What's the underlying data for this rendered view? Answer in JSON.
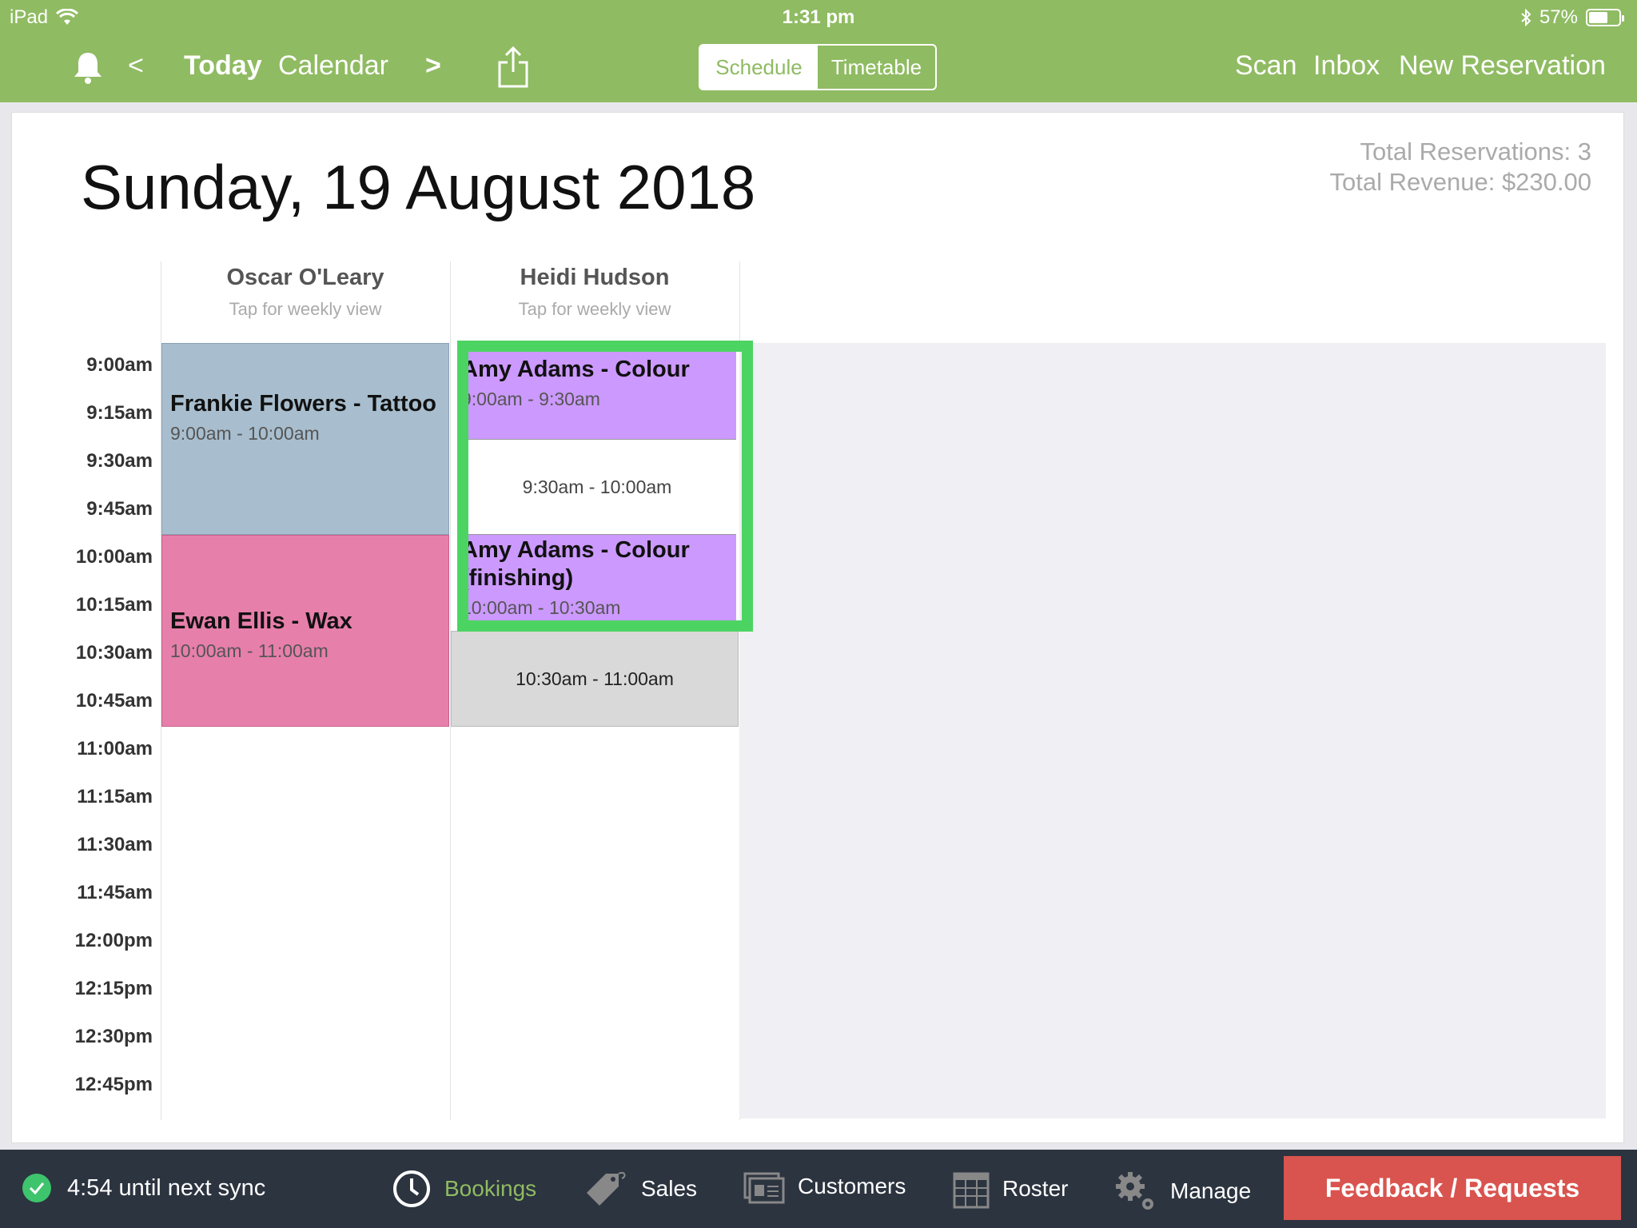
{
  "status_bar": {
    "device": "iPad",
    "time": "1:31 pm",
    "battery": "57%"
  },
  "nav": {
    "back": "<",
    "today": "Today",
    "calendar": "Calendar",
    "forward": ">",
    "segments": [
      "Schedule",
      "Timetable"
    ],
    "active_segment": "Schedule",
    "scan": "Scan",
    "inbox": "Inbox",
    "new_reservation": "New Reservation"
  },
  "main": {
    "date_title": "Sunday, 19 August 2018",
    "total_reservations": "Total Reservations: 3",
    "total_revenue": "Total Revenue: $230.00",
    "staff": [
      {
        "name": "Oscar O'Leary",
        "sub": "Tap for weekly view"
      },
      {
        "name": "Heidi Hudson",
        "sub": "Tap for weekly view"
      }
    ],
    "time_labels": [
      "9:00am",
      "9:15am",
      "9:30am",
      "9:45am",
      "10:00am",
      "10:15am",
      "10:30am",
      "10:45am",
      "11:00am",
      "11:15am",
      "11:30am",
      "11:45am",
      "12:00pm",
      "12:15pm",
      "12:30pm",
      "12:45pm"
    ],
    "appointments": [
      {
        "title": "Frankie Flowers - Tattoo",
        "time": "9:00am - 10:00am",
        "color": "#a8bece"
      },
      {
        "title": "Ewan Ellis - Wax",
        "time": "10:00am - 11:00am",
        "color": "#e77fab"
      },
      {
        "title": "Amy Adams - Colour",
        "time": "9:00am - 9:30am",
        "color": "#cc99ff"
      },
      {
        "title": "Amy Adams - Colour (finishing)",
        "time": "10:00am - 10:30am",
        "color": "#cc99ff"
      }
    ],
    "slots": [
      {
        "label": "9:30am - 10:00am"
      },
      {
        "label": "10:30am - 11:00am"
      }
    ]
  },
  "bottom": {
    "sync": "4:54 until next sync",
    "tabs": [
      "Bookings",
      "Sales",
      "Customers",
      "Roster",
      "Manage"
    ],
    "active_tab": "Bookings",
    "feedback": "Feedback / Requests"
  },
  "colors": {
    "brand_green": "#8fbb62",
    "highlight_green": "#4cd463",
    "feedback_red": "#d9544f",
    "bottom_bg": "#2c3440"
  }
}
